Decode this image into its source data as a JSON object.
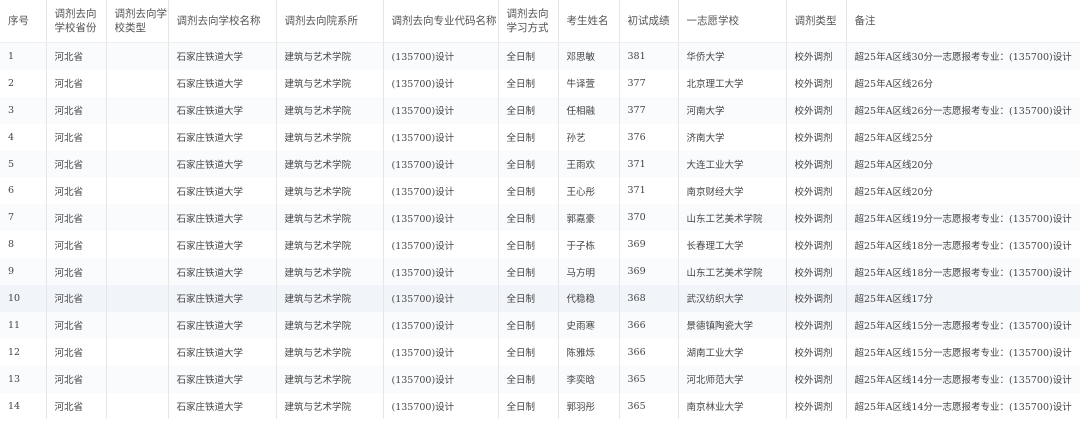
{
  "headers": [
    "序号",
    "调剂去向学校省份",
    "调剂去向学校类型",
    "调剂去向学校名称",
    "调剂去向院系所",
    "调剂去向专业代码名称",
    "调剂去向学习方式",
    "考生姓名",
    "初试成绩",
    "一志愿学校",
    "调剂类型",
    "备注"
  ],
  "rows": [
    [
      "1",
      "河北省",
      "",
      "石家庄铁道大学",
      "建筑与艺术学院",
      "(135700)设计",
      "全日制",
      "邓思敏",
      "381",
      "华侨大学",
      "校外调剂",
      "超25年A区线30分一志愿报考专业：(135700)设计"
    ],
    [
      "2",
      "河北省",
      "",
      "石家庄铁道大学",
      "建筑与艺术学院",
      "(135700)设计",
      "全日制",
      "牛译萱",
      "377",
      "北京理工大学",
      "校外调剂",
      "超25年A区线26分"
    ],
    [
      "3",
      "河北省",
      "",
      "石家庄铁道大学",
      "建筑与艺术学院",
      "(135700)设计",
      "全日制",
      "任相融",
      "377",
      "河南大学",
      "校外调剂",
      "超25年A区线26分一志愿报考专业：(135700)设计"
    ],
    [
      "4",
      "河北省",
      "",
      "石家庄铁道大学",
      "建筑与艺术学院",
      "(135700)设计",
      "全日制",
      "孙艺",
      "376",
      "济南大学",
      "校外调剂",
      "超25年A区线25分"
    ],
    [
      "5",
      "河北省",
      "",
      "石家庄铁道大学",
      "建筑与艺术学院",
      "(135700)设计",
      "全日制",
      "王雨欢",
      "371",
      "大连工业大学",
      "校外调剂",
      "超25年A区线20分"
    ],
    [
      "6",
      "河北省",
      "",
      "石家庄铁道大学",
      "建筑与艺术学院",
      "(135700)设计",
      "全日制",
      "王心彤",
      "371",
      "南京财经大学",
      "校外调剂",
      "超25年A区线20分"
    ],
    [
      "7",
      "河北省",
      "",
      "石家庄铁道大学",
      "建筑与艺术学院",
      "(135700)设计",
      "全日制",
      "郭嘉豪",
      "370",
      "山东工艺美术学院",
      "校外调剂",
      "超25年A区线19分一志愿报考专业：(135700)设计"
    ],
    [
      "8",
      "河北省",
      "",
      "石家庄铁道大学",
      "建筑与艺术学院",
      "(135700)设计",
      "全日制",
      "于子栋",
      "369",
      "长春理工大学",
      "校外调剂",
      "超25年A区线18分一志愿报考专业：(135700)设计"
    ],
    [
      "9",
      "河北省",
      "",
      "石家庄铁道大学",
      "建筑与艺术学院",
      "(135700)设计",
      "全日制",
      "马方明",
      "369",
      "山东工艺美术学院",
      "校外调剂",
      "超25年A区线18分一志愿报考专业：(135700)设计"
    ],
    [
      "10",
      "河北省",
      "",
      "石家庄铁道大学",
      "建筑与艺术学院",
      "(135700)设计",
      "全日制",
      "代稳稳",
      "368",
      "武汉纺织大学",
      "校外调剂",
      "超25年A区线17分"
    ],
    [
      "11",
      "河北省",
      "",
      "石家庄铁道大学",
      "建筑与艺术学院",
      "(135700)设计",
      "全日制",
      "史雨寒",
      "366",
      "景德镇陶瓷大学",
      "校外调剂",
      "超25年A区线15分一志愿报考专业：(135700)设计"
    ],
    [
      "12",
      "河北省",
      "",
      "石家庄铁道大学",
      "建筑与艺术学院",
      "(135700)设计",
      "全日制",
      "陈雅烁",
      "366",
      "湖南工业大学",
      "校外调剂",
      "超25年A区线15分一志愿报考专业：(135700)设计"
    ],
    [
      "13",
      "河北省",
      "",
      "石家庄铁道大学",
      "建筑与艺术学院",
      "(135700)设计",
      "全日制",
      "李奕晗",
      "365",
      "河北师范大学",
      "校外调剂",
      "超25年A区线14分一志愿报考专业：(135700)设计"
    ],
    [
      "14",
      "河北省",
      "",
      "石家庄铁道大学",
      "建筑与艺术学院",
      "(135700)设计",
      "全日制",
      "郭羽彤",
      "365",
      "南京林业大学",
      "校外调剂",
      "超25年A区线14分一志愿报考专业：(135700)设计"
    ]
  ]
}
